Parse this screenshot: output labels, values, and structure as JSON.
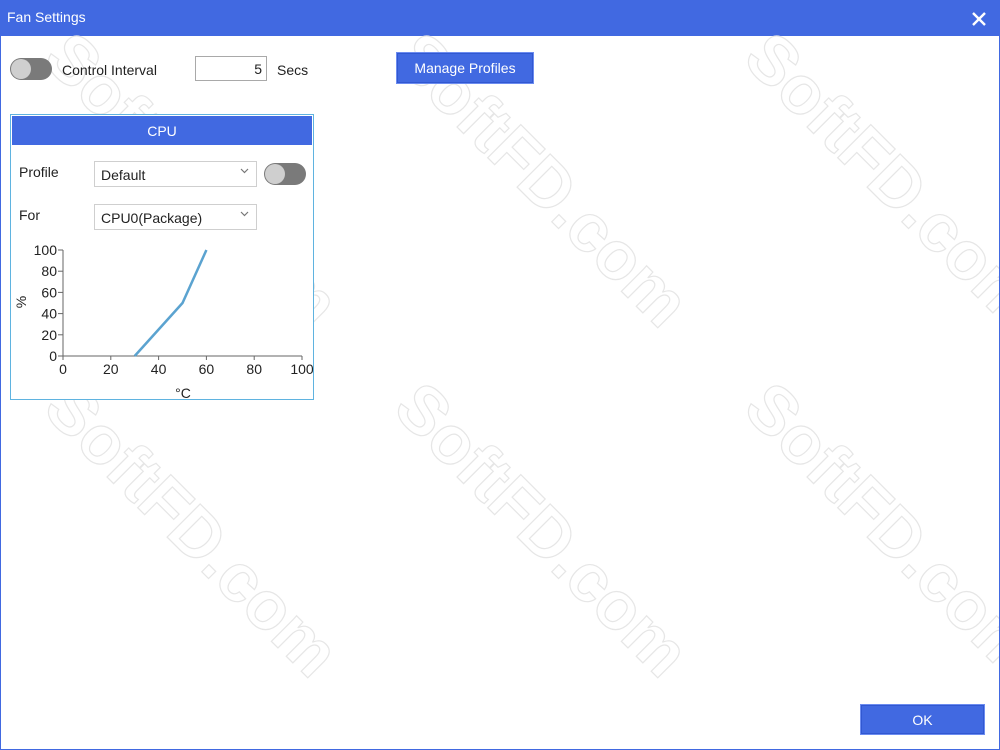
{
  "window": {
    "title": "Fan Settings"
  },
  "toolbar": {
    "control_interval_label": "Control Interval",
    "interval_value": "5",
    "interval_unit": "Secs",
    "manage_profiles_label": "Manage Profiles"
  },
  "cpu_panel": {
    "header": "CPU",
    "profile_label": "Profile",
    "profile_value": "Default",
    "for_label": "For",
    "for_value": "CPU0(Package)"
  },
  "footer": {
    "ok_label": "OK"
  },
  "watermark_text": "SoftFD.com",
  "colors": {
    "accent": "#4169e1",
    "curve": "#5ba3d0",
    "toggle_off": "#7a7a7a"
  },
  "chart_data": {
    "type": "line",
    "xlabel": "°C",
    "ylabel": "%",
    "xlim": [
      0,
      100
    ],
    "ylim": [
      0,
      100
    ],
    "x_ticks": [
      "0",
      "20",
      "40",
      "60",
      "80",
      "100"
    ],
    "y_ticks": [
      "0",
      "20",
      "40",
      "60",
      "80",
      "100"
    ],
    "series": [
      {
        "x": [
          30,
          50,
          60
        ],
        "y": [
          0,
          50,
          100
        ]
      }
    ]
  }
}
